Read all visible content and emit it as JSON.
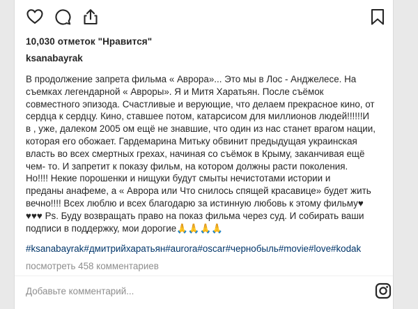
{
  "post": {
    "likes_text": "10,030 отметок \"Нравится\"",
    "username": "ksanabayrak",
    "caption_lines": [
      "В продолжение запрета фильма « Аврора»... Это мы в Лос - Анджелесе. На",
      "съемках легендарной « Авроры». Я и Митя Харатьян. После съёмок",
      "совместного эпизода. Счастливые и верующие, что делаем прекрасное кино, от",
      "сердца к сердцу. Кино, ставшее потом, катарсисом для миллионов людей!!!!!!И",
      "в , уже, далеком 2005 ом ещё не знавшие, что один из нас станет врагом нации,",
      "которая его обожает. Гардемарина Митьку обвинит предыдущая украинская",
      "власть во всех смертных грехах, начиная со съёмок в Крыму, заканчивая ещё",
      "чем- то. И запретит к показу фильм, на котором должны расти поколения.",
      "Но!!!! Некие порошенки и нищуки будут смыты нечистотами истории и",
      "преданы анафеме, а « Аврора или Что снилось спящей красавице» будет жить",
      "вечно!!!! Всех люблю и всех благодарю за истинную любовь к этому фильму♥",
      "♥♥♥ Ps. Буду возвращать право на показ фильма через суд. И собирать ваши",
      "подписи в поддержку, мои дорогие🙏🙏🙏🙏"
    ],
    "hashtags": [
      "#ksanabayrak",
      "#дмитрийхаратьян",
      "#aurora",
      "#oscar",
      "#чернобыль",
      "#movie",
      "#love",
      "#kodak"
    ],
    "view_comments": "посмотреть 458 комментариев",
    "comment_placeholder": "Добавьте комментарий..."
  },
  "colors": {
    "text": "#262626",
    "hashtag": "#003569",
    "muted": "#8e8e8e",
    "background": "#e9e9e9",
    "panel": "#ffffff"
  },
  "icons": [
    "heart-icon",
    "comment-icon",
    "share-icon",
    "bookmark-icon",
    "instagram-icon"
  ]
}
